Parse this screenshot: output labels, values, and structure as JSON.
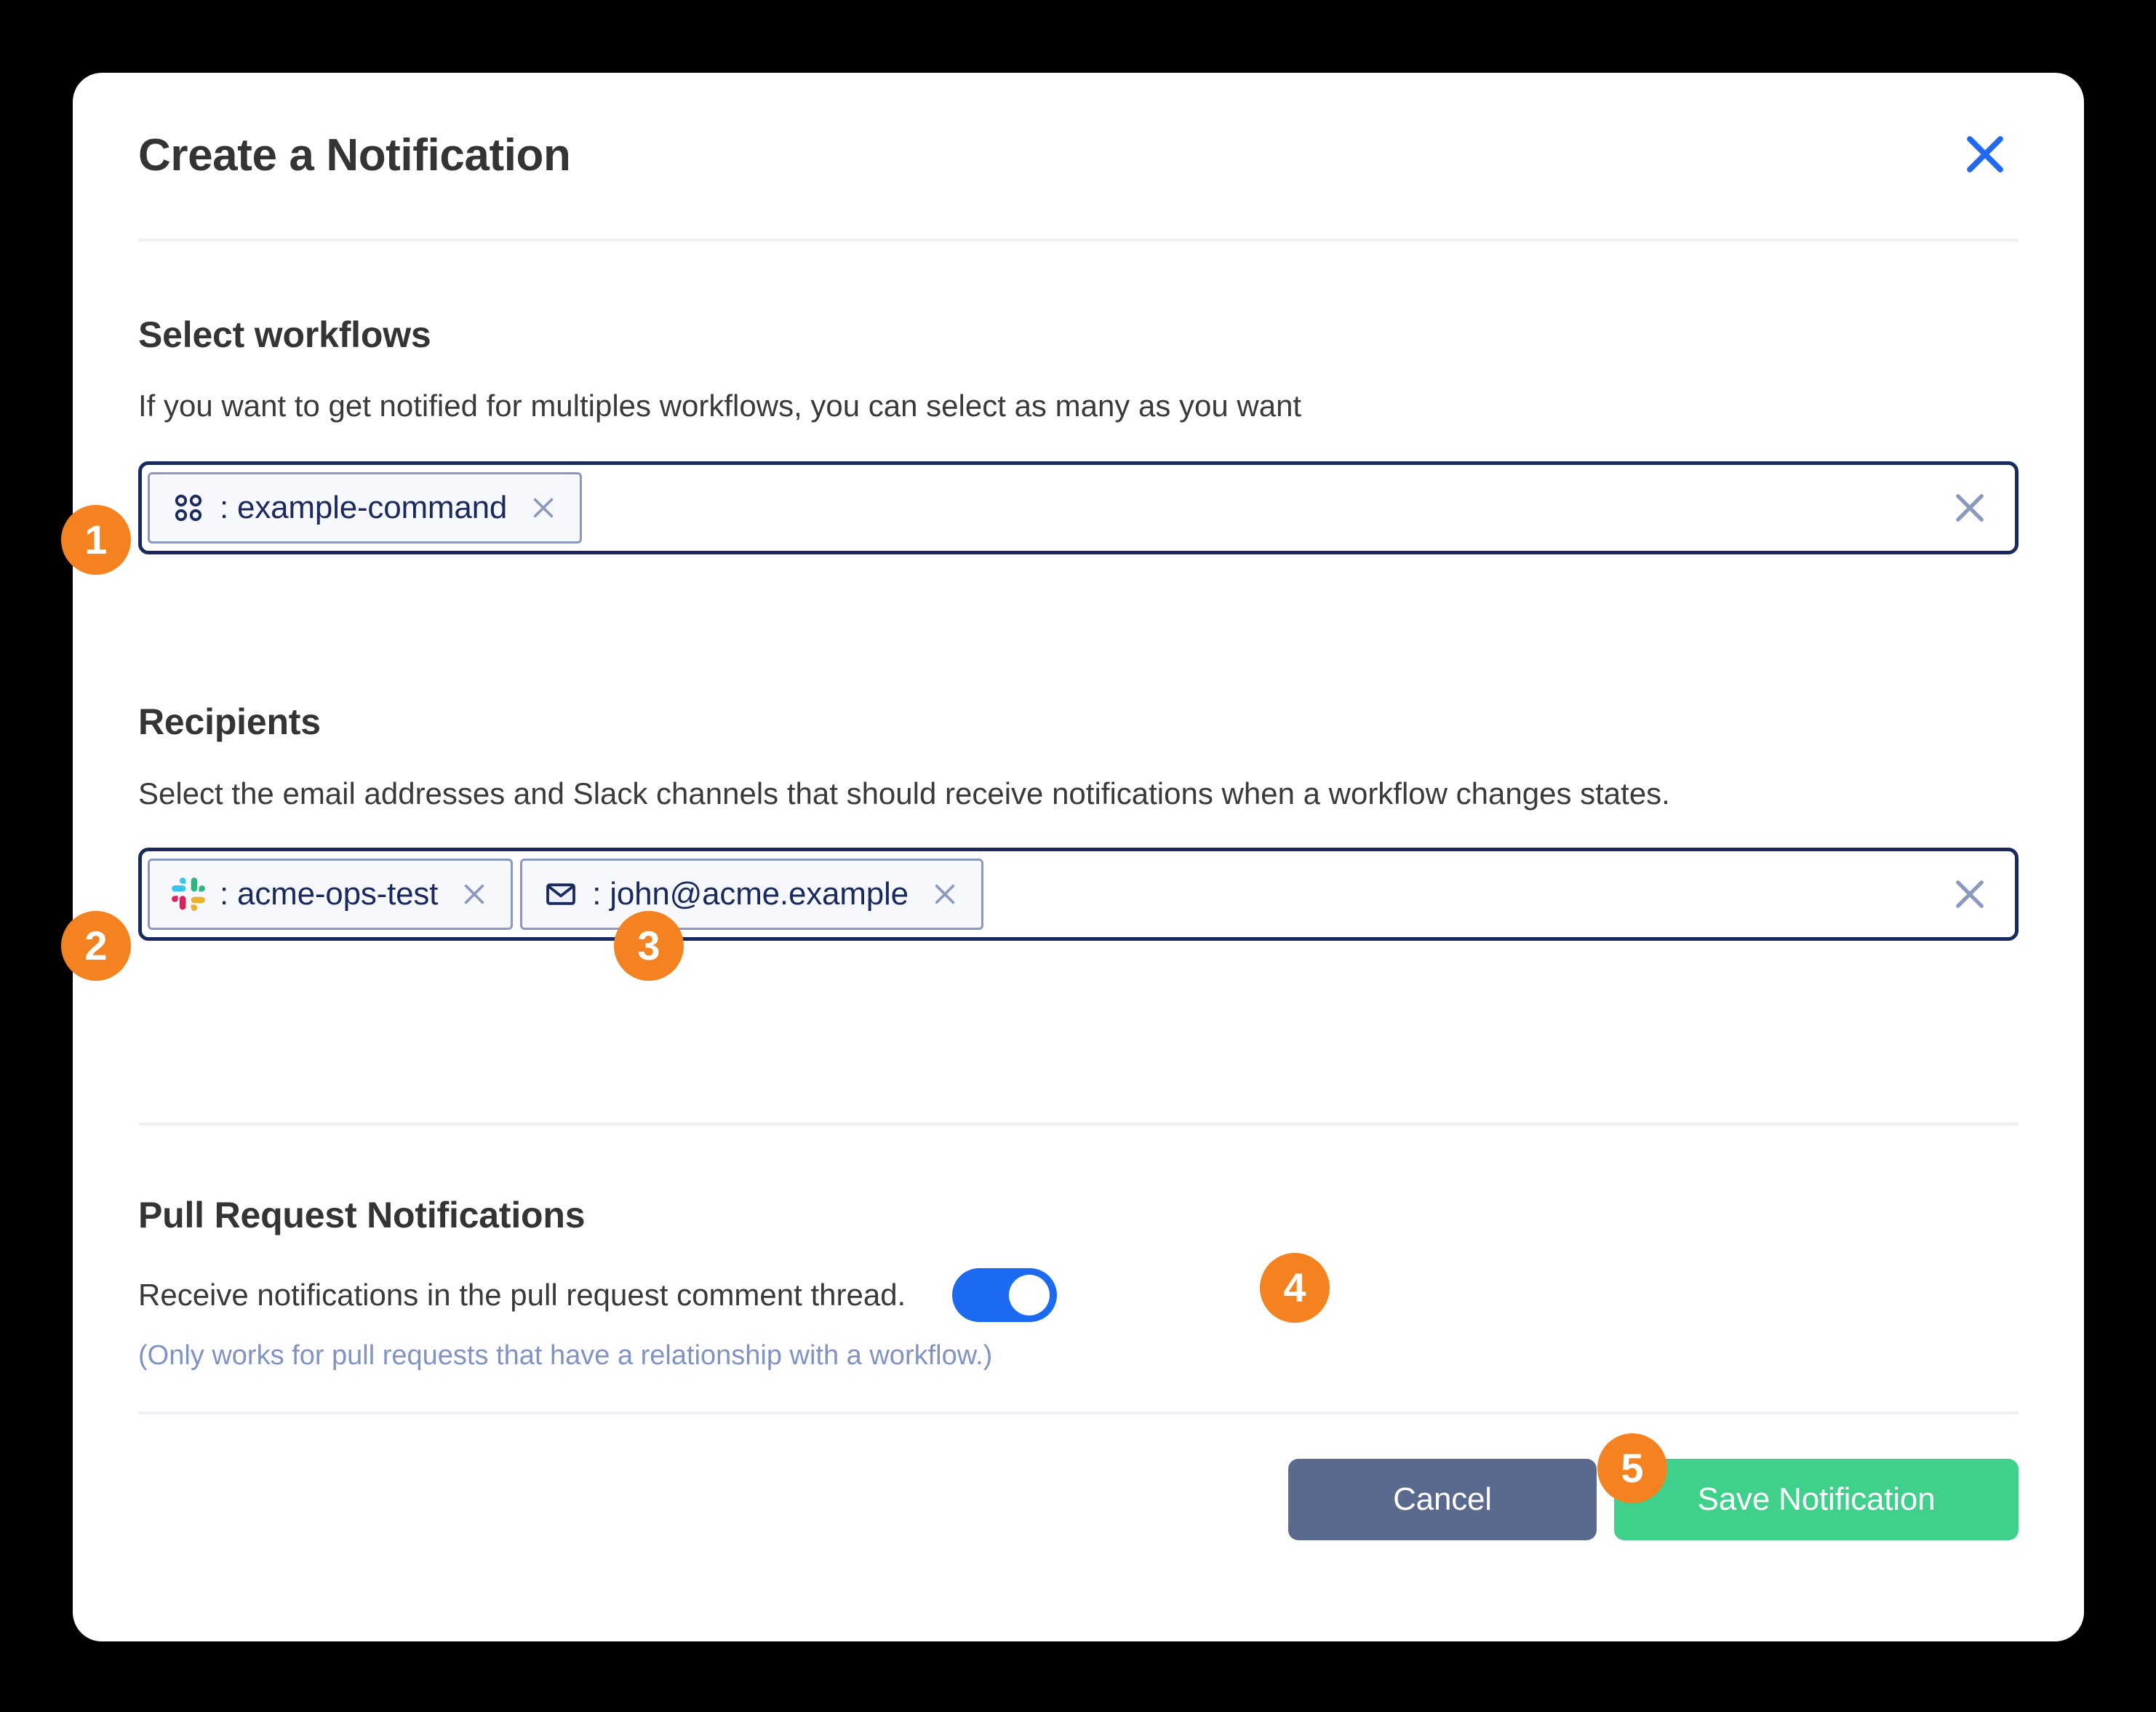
{
  "dialog": {
    "title": "Create a Notification",
    "close_icon": "close-icon"
  },
  "workflows": {
    "heading": "Select workflows",
    "description": "If you want to get notified for multiples workflows, you can select as many as you want",
    "chips": [
      {
        "icon": "workflow-grid-icon",
        "label": ": example-command",
        "remove_icon": "chip-remove-icon"
      }
    ],
    "clear_icon": "field-clear-icon"
  },
  "recipients": {
    "heading": "Recipients",
    "description": "Select the email addresses and Slack channels that should receive notifications when a workflow changes states.",
    "chips": [
      {
        "icon": "slack-icon",
        "label": ": acme-ops-test",
        "remove_icon": "chip-remove-icon"
      },
      {
        "icon": "email-icon",
        "label": ": john@acme.example",
        "remove_icon": "chip-remove-icon"
      }
    ],
    "clear_icon": "field-clear-icon"
  },
  "pull_request": {
    "heading": "Pull Request Notifications",
    "description": "Receive notifications in the pull request comment thread.",
    "note": "(Only works for pull requests that have a relationship with a workflow.)",
    "toggle_state": "on"
  },
  "footer": {
    "cancel_label": "Cancel",
    "save_label": "Save Notification"
  },
  "badges": [
    {
      "number": "1"
    },
    {
      "number": "2"
    },
    {
      "number": "3"
    },
    {
      "number": "4"
    },
    {
      "number": "5"
    }
  ],
  "colors": {
    "accent_blue": "#1d6af2",
    "badge_orange": "#f58220",
    "save_green": "#3fd18b",
    "cancel_slate": "#5a6a8e",
    "navy_border": "#1b2a5e",
    "muted_blue": "#8193c4",
    "slack_cyan": "#36c5f0",
    "slack_green": "#2eb67d",
    "slack_crimson": "#e01e5a",
    "slack_yellow": "#ecb22e"
  }
}
